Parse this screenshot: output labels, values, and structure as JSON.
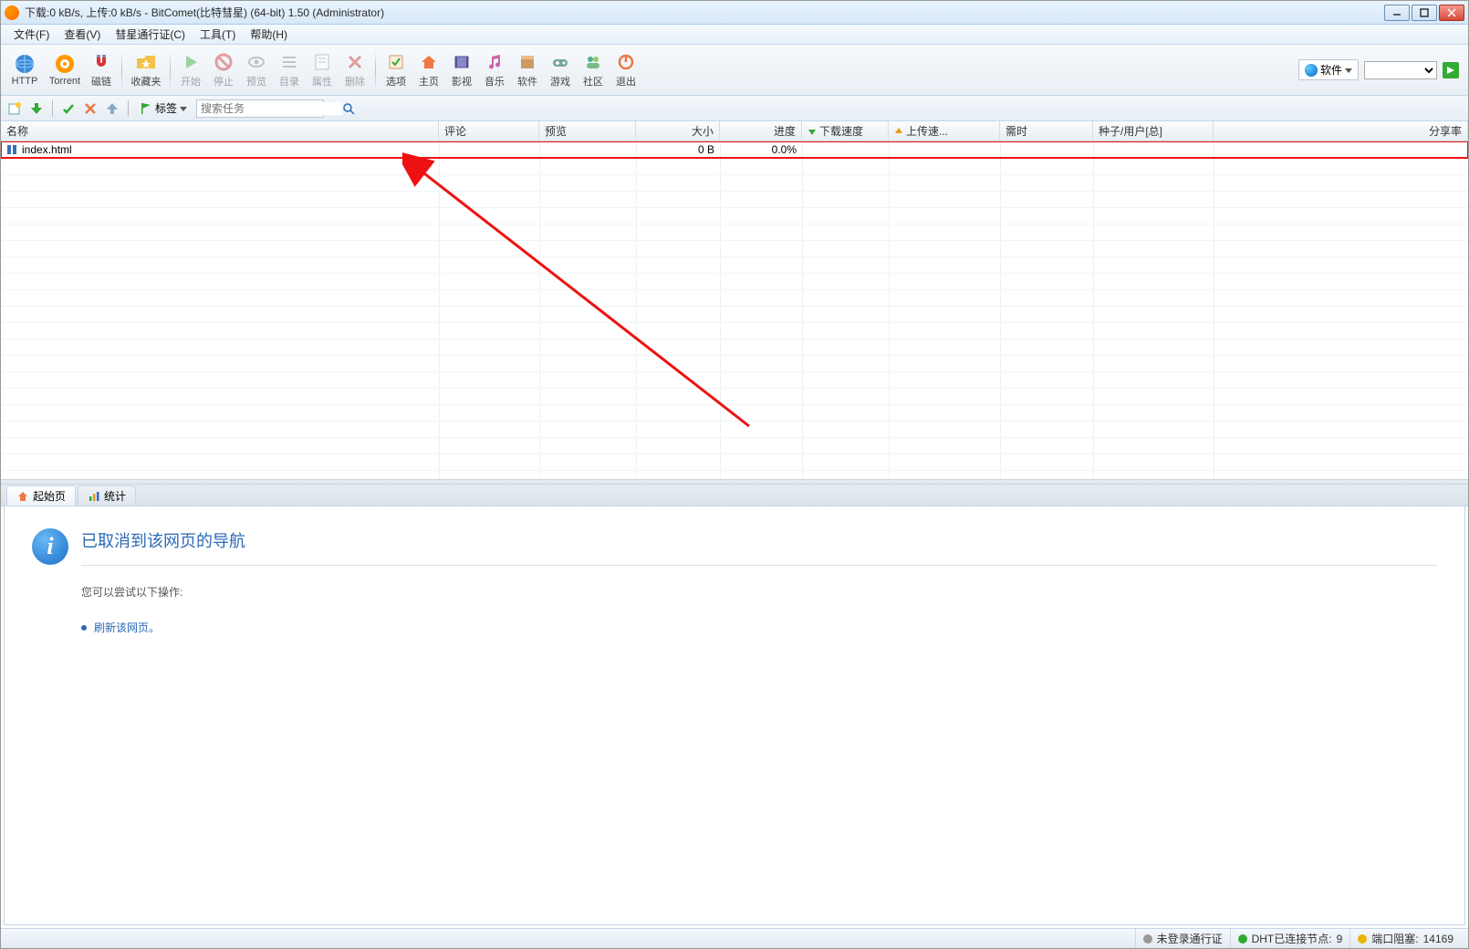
{
  "title": "下载:0 kB/s, 上传:0 kB/s - BitComet(比特彗星) (64-bit) 1.50 (Administrator)",
  "menu": {
    "file": "文件(F)",
    "view": "查看(V)",
    "passport": "彗星通行证(C)",
    "tools": "工具(T)",
    "help": "帮助(H)"
  },
  "toolbar": {
    "http": "HTTP",
    "torrent": "Torrent",
    "magnet": "磁链",
    "fav": "收藏夹",
    "start": "开始",
    "stop": "停止",
    "preview": "预览",
    "list": "目录",
    "prop": "属性",
    "delete": "删除",
    "options": "选项",
    "home": "主页",
    "video": "影视",
    "music": "音乐",
    "software": "软件",
    "game": "游戏",
    "community": "社区",
    "exit": "退出"
  },
  "toolbar_right": {
    "soft_label": "软件"
  },
  "toolbar2": {
    "tags": "标签",
    "search_placeholder": "搜索任务"
  },
  "columns": {
    "name": "名称",
    "comment": "评论",
    "preview": "预览",
    "size": "大小",
    "progress": "进度",
    "dl": "下载速度",
    "ul": "上传速...",
    "time": "需时",
    "seeds": "种子/用户[总]",
    "share": "分享率"
  },
  "task": {
    "name": "index.html",
    "size": "0 B",
    "progress": "0.0%"
  },
  "tabs": {
    "start": "起始页",
    "stats": "统计"
  },
  "page": {
    "title": "已取消到该网页的导航",
    "hint": "您可以尝试以下操作:",
    "refresh": "刷新该网页。"
  },
  "status": {
    "login": "未登录通行证",
    "dht_label": "DHT已连接节点:",
    "dht_count": "9",
    "port_label": "端口阻塞:",
    "port_value": "14169"
  }
}
